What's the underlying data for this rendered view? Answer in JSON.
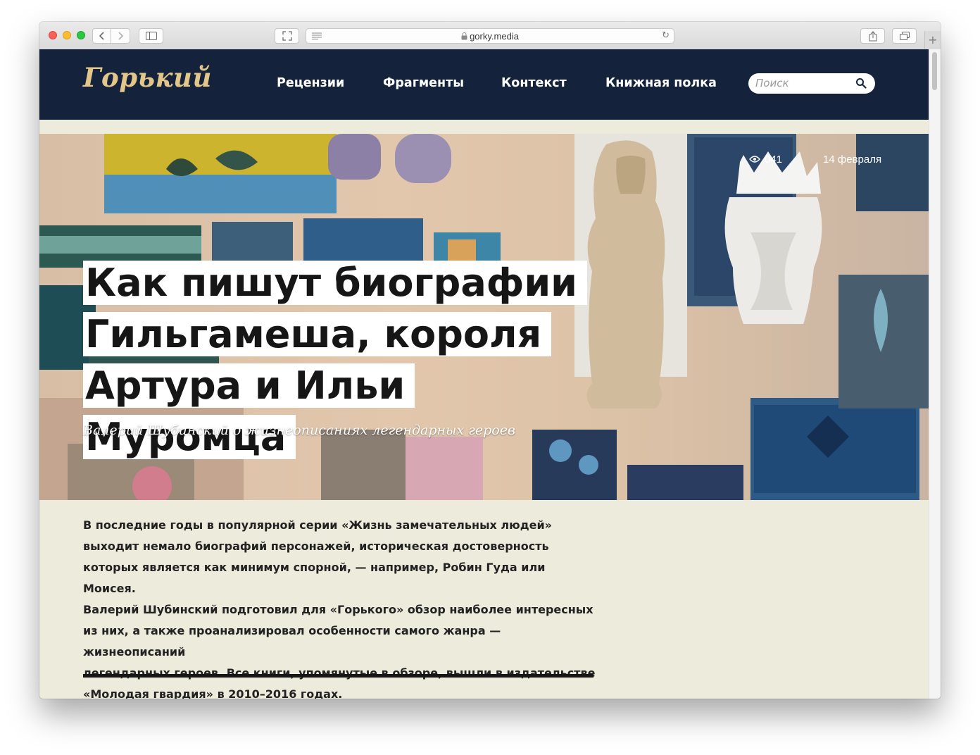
{
  "browser": {
    "url": "gorky.media",
    "reload_symbol": "↻",
    "plus_symbol": "+"
  },
  "site": {
    "logo": "Горький",
    "nav": [
      "Рецензии",
      "Фрагменты",
      "Контекст",
      "Книжная полка"
    ],
    "search_placeholder": "Поиск"
  },
  "article": {
    "views": "041",
    "date": "14 февраля",
    "title_lines": [
      "Как пишут биографии",
      "Гильгамеша, короля",
      "Артура и Ильи Муромца"
    ],
    "subtitle": "Валерий Шубинский о жизнеописаниях легендарных героев",
    "lead_lines": [
      "В последние годы в популярной серии «Жизнь замечательных людей»",
      "выходит немало биографий персонажей, историческая достоверность",
      "которых является как минимум спорной, — например, Робин Гуда или Моисея.",
      "Валерий Шубинский подготовил для «Горького» обзор наиболее интересных",
      "из них, а также проанализировал особенности самого жанра — жизнеописаний",
      "легендарных героев. Все книги, упомянутые в обзоре, вышли в издательстве",
      "«Молодая гвардия» в 2010–2016 годах."
    ]
  },
  "colors": {
    "header_bg": "#14233b",
    "logo": "#e3c78a",
    "page_bg": "#ecebdc",
    "text": "#222222"
  }
}
